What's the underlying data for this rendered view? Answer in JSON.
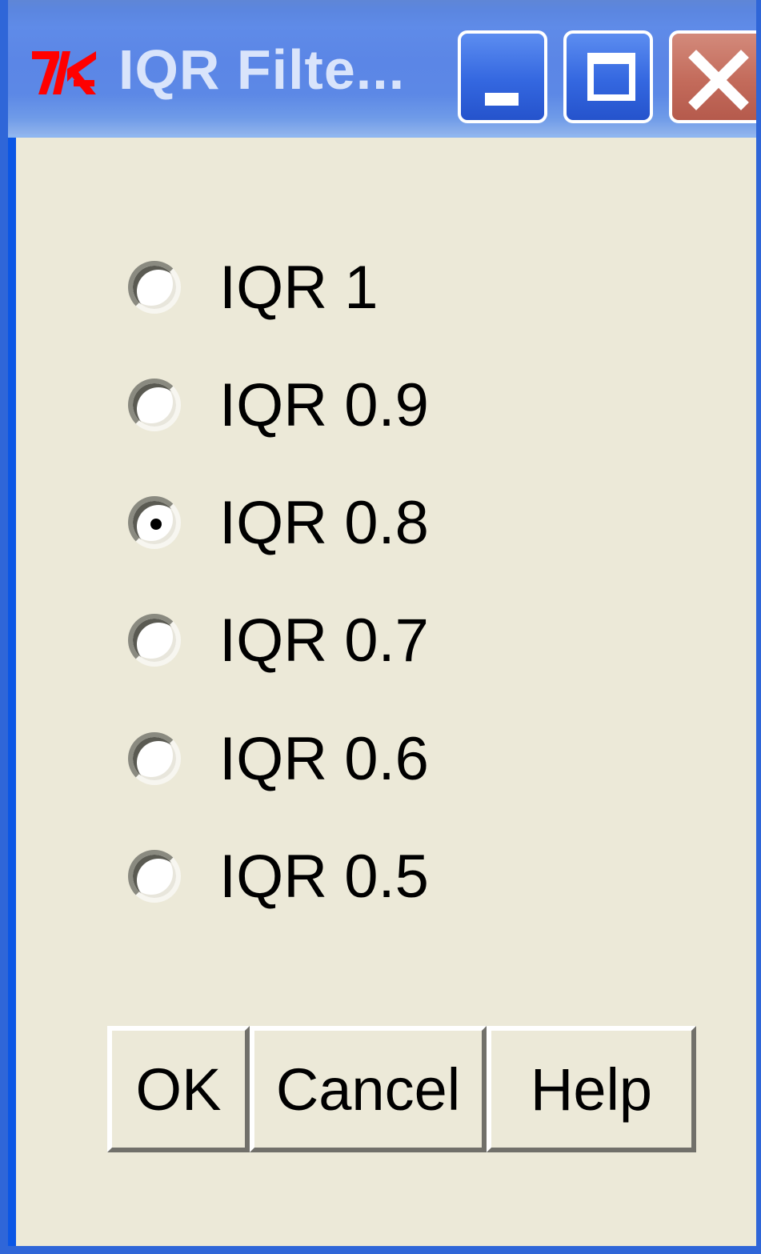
{
  "window": {
    "title": "IQR Filte...",
    "icon": "tk-feather-icon",
    "controls": {
      "minimize": "minimize-icon",
      "maximize": "maximize-icon",
      "close": "close-icon"
    }
  },
  "radio_options": [
    {
      "label": "IQR 1",
      "checked": false
    },
    {
      "label": "IQR 0.9",
      "checked": false
    },
    {
      "label": "IQR 0.8",
      "checked": true
    },
    {
      "label": "IQR 0.7",
      "checked": false
    },
    {
      "label": "IQR 0.6",
      "checked": false
    },
    {
      "label": "IQR 0.5",
      "checked": false
    }
  ],
  "buttons": {
    "ok": "OK",
    "cancel": "Cancel",
    "help": "Help"
  },
  "colors": {
    "titlebar": "#5b86e6",
    "dialog_bg": "#ece9d8",
    "close_button": "#c36b5b",
    "tk_icon": "#ff0000"
  }
}
